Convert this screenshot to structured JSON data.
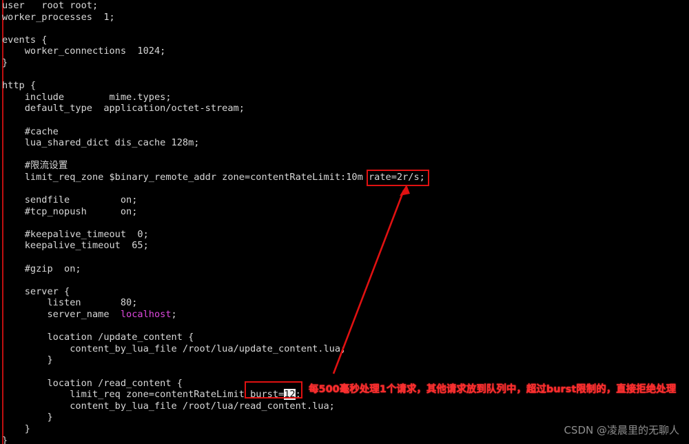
{
  "terminal": {
    "background_color": "#000000",
    "foreground_color": "#d8d8d8",
    "accent_color": "#e01111",
    "string_color": "#e048e0",
    "selection_bg": "#f2f2f2",
    "file_kind": "nginx.conf"
  },
  "code_lines": [
    {
      "text": "user   root root;"
    },
    {
      "text": "worker_processes  1;"
    },
    {
      "text": ""
    },
    {
      "text": "events {"
    },
    {
      "text": "    worker_connections  1024;"
    },
    {
      "text": "}"
    },
    {
      "text": ""
    },
    {
      "text": "http {"
    },
    {
      "text": "    include        mime.types;"
    },
    {
      "text": "    default_type  application/octet-stream;"
    },
    {
      "text": ""
    },
    {
      "text": "    #cache"
    },
    {
      "text": "    lua_shared_dict dis_cache 128m;"
    },
    {
      "text": ""
    },
    {
      "text": "    #限流设置"
    },
    {
      "text": "    limit_req_zone $binary_remote_addr zone=contentRateLimit:10m rate=2r/s;"
    },
    {
      "text": ""
    },
    {
      "text": "    sendfile         on;"
    },
    {
      "text": "    #tcp_nopush      on;"
    },
    {
      "text": ""
    },
    {
      "text": "    #keepalive_timeout  0;"
    },
    {
      "text": "    keepalive_timeout  65;"
    },
    {
      "text": ""
    },
    {
      "text": "    #gzip  on;"
    },
    {
      "text": ""
    },
    {
      "text": "    server {"
    },
    {
      "text": "        listen       80;"
    },
    {
      "text": "        server_name  localhost;"
    },
    {
      "text": ""
    },
    {
      "text": "        location /update_content {"
    },
    {
      "text": "            content_by_lua_file /root/lua/update_content.lua;"
    },
    {
      "text": "        }"
    },
    {
      "text": ""
    },
    {
      "text": "        location /read_content {"
    },
    {
      "text": "            limit_req zone=contentRateLimit burst=12;"
    },
    {
      "text": "            content_by_lua_file /root/lua/read_content.lua;"
    },
    {
      "text": "        }"
    },
    {
      "text": "    }"
    },
    {
      "text": "}"
    }
  ],
  "highlights": {
    "server_name_value": "localhost",
    "selected_text": "12"
  },
  "annotations": {
    "rate_box_label": "rate=2r/s;",
    "burst_box_label": "burst=12;",
    "burst_note": "每500毫秒处理1个请求，其他请求放到队列中，超过burst限制的，直接拒绝处理",
    "arrow_from": "burst=12",
    "arrow_to": "rate=2r/s;"
  },
  "watermark": {
    "text": "CSDN @凌晨里的无聊人"
  }
}
